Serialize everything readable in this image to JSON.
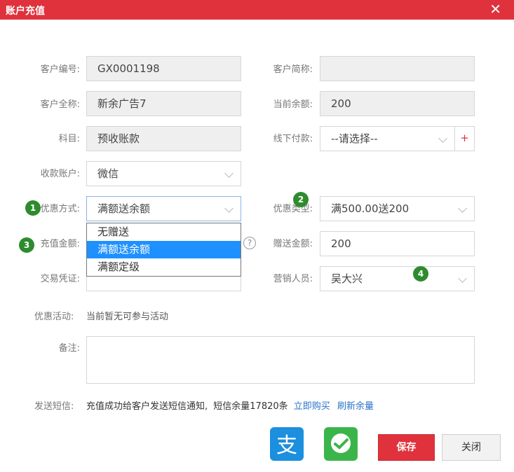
{
  "window": {
    "title": "账户充值",
    "close_glyph": "✕"
  },
  "form": {
    "customer_no": {
      "label": "客户编号:",
      "value": "GX0001198"
    },
    "customer_short": {
      "label": "客户简称:",
      "value": ""
    },
    "customer_full": {
      "label": "客户全称:",
      "value": "新余广告7"
    },
    "balance": {
      "label": "当前余额:",
      "value": "200"
    },
    "subject": {
      "label": "科目:",
      "value": "预收账款"
    },
    "offline_pay": {
      "label": "线下付款:",
      "value": "--请选择--",
      "add": "+"
    },
    "account": {
      "label": "收款账户:",
      "value": "微信"
    },
    "discount_method": {
      "label": "优惠方式:",
      "value": "满额送余额"
    },
    "discount_type": {
      "label": "优惠类型:",
      "value": "满500.00送200"
    },
    "recharge_amount": {
      "label": "充值金额:",
      "value": ""
    },
    "gift_amount": {
      "label": "赠送金额:",
      "value": "200"
    },
    "voucher": {
      "label": "交易凭证:"
    },
    "salesperson": {
      "label": "营销人员:",
      "value": "吴大兴"
    },
    "promotion": {
      "label": "优惠活动:",
      "value": "当前暂无可参与活动"
    },
    "remark": {
      "label": "备注:",
      "value": ""
    },
    "sms": {
      "label": "发送短信:",
      "text": "充值成功给客户发送短信通知,",
      "balance": "短信余量17820条",
      "buy": "立即购买",
      "refresh": "刷新余量"
    }
  },
  "dropdown_options": [
    "无赠送",
    "满额送余额",
    "满额定级"
  ],
  "badges": [
    "1",
    "2",
    "3",
    "4"
  ],
  "buttons": {
    "save": "保存",
    "close": "关闭"
  },
  "help_glyph": "?",
  "colors": {
    "brand": "#e0323c",
    "selection": "#1e90ff",
    "badge": "#2e8b2e",
    "alipay": "#1c8fde",
    "wechat": "#3bb54a",
    "link": "#2a73c8"
  }
}
